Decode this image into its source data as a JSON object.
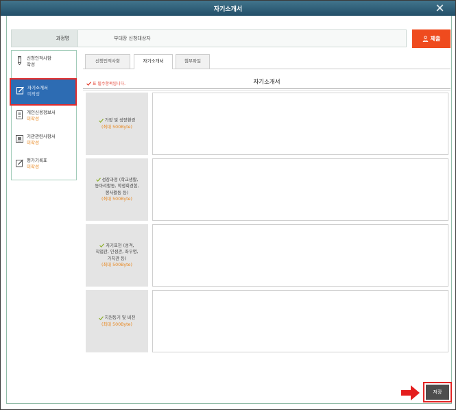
{
  "window": {
    "title": "자기소개서",
    "close_icon": "close-icon"
  },
  "info": {
    "label": "과정명",
    "value": "부대장 신청대상자"
  },
  "submit": {
    "label": "제출",
    "icon": "user-icon"
  },
  "sidebar": {
    "items": [
      {
        "label": "신청인적사항",
        "sub": "작성",
        "icon": "pencil-icon",
        "active": false
      },
      {
        "label": "자기소개서",
        "sub": "미작성",
        "icon": "edit-box-icon",
        "active": true
      },
      {
        "label": "개인신용정보서",
        "sub": "미작성",
        "icon": "document-icon",
        "active": false
      },
      {
        "label": "기관관련사항서",
        "sub": "미작성",
        "icon": "id-card-icon",
        "active": false
      },
      {
        "label": "평가기록표",
        "sub": "미작성",
        "icon": "edit-icon",
        "active": false
      }
    ]
  },
  "tabs": [
    {
      "label": "신청인적사항",
      "active": false
    },
    {
      "label": "자기소개서",
      "active": true
    },
    {
      "label": "첨부파일",
      "active": false
    }
  ],
  "form": {
    "required_note": "표 필수항목입니다.",
    "heading": "자기소개서",
    "fields": [
      {
        "lines": [
          "가정 및 성장환경"
        ],
        "limit": "(최대 500Byte)",
        "value": ""
      },
      {
        "lines": [
          "성장과정 (학교생활,",
          "동아리활동, 학생회경험,",
          "봉사활동 등)"
        ],
        "limit": "(최대 500Byte)",
        "value": ""
      },
      {
        "lines": [
          "자기표현 (성격,",
          "직업관, 인생관, 좌우명,",
          "가치관 등)"
        ],
        "limit": "(최대 500Byte)",
        "value": ""
      },
      {
        "lines": [
          "지원동기 및 비전"
        ],
        "limit": "(최대 500Byte)",
        "value": ""
      }
    ]
  },
  "save": {
    "label": "저장"
  },
  "annotation": {
    "arrow_icon": "arrow-right-icon"
  },
  "colors": {
    "title_bar": "#234f68",
    "submit": "#ef4b1e",
    "active_item": "#2d6cb3",
    "highlight_border": "#e22b2b",
    "status": "#e8861c",
    "required_note": "#e23a2a",
    "save_button": "#4d4d4d"
  }
}
